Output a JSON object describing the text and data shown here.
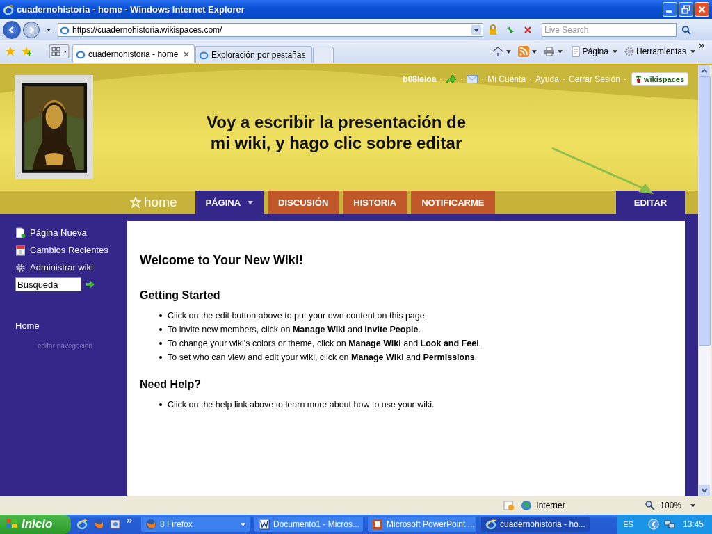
{
  "window": {
    "title": "cuadernohistoria - home - Windows Internet Explorer"
  },
  "address_bar": {
    "url": "https://cuadernohistoria.wikispaces.com/",
    "search_placeholder": "Live Search"
  },
  "tabs": [
    {
      "label": "cuadernohistoria - home",
      "selected": true
    },
    {
      "label": "Exploración por pestañas",
      "selected": false
    }
  ],
  "command_bar": [
    "Página",
    "Herramientas"
  ],
  "page": {
    "user": "b08leioa",
    "links": [
      "Mi Cuenta",
      "Ayuda",
      "Cerrar Sesión"
    ],
    "logo": "wikispaces",
    "banner": [
      "Voy a escribir la presentación de",
      "mi wiki, y hago clic sobre editar"
    ],
    "page_name": "home",
    "nav_tabs": [
      {
        "label": "PÁGINA",
        "selected": true,
        "dropdown": true
      },
      {
        "label": "DISCUSIÓN",
        "selected": false,
        "dropdown": false
      },
      {
        "label": "HISTORIA",
        "selected": false,
        "dropdown": false
      },
      {
        "label": "NOTIFICARME",
        "selected": false,
        "dropdown": false
      }
    ],
    "edit_button": "EDITAR"
  },
  "sidebar": {
    "items": [
      {
        "label": "Página Nueva",
        "kind": "new-page"
      },
      {
        "label": "Cambios Recientes",
        "kind": "calendar"
      },
      {
        "label": "Administrar wiki",
        "kind": "gear"
      }
    ],
    "search_value": "Búsqueda",
    "nav_links": [
      "Home"
    ],
    "edit_nav": "editar navegación"
  },
  "content": {
    "title": "Welcome to Your New Wiki!",
    "sections": [
      {
        "heading": "Getting Started",
        "bullets": [
          "Click on the edit button above to put your own content on this page.",
          "To invite new members, click on **Manage Wiki** and **Invite People**.",
          "To change your wiki's colors or theme, click on **Manage Wiki** and **Look and Feel**.",
          "To set who can view and edit your wiki, click on **Manage Wiki** and **Permissions**."
        ]
      },
      {
        "heading": "Need Help?",
        "bullets": [
          "Click on the help link above to learn more about how to use your wiki."
        ]
      }
    ]
  },
  "status_bar": {
    "zone": "Internet",
    "zoom": "100%"
  },
  "taskbar": {
    "start": "Inicio",
    "tasks": [
      {
        "label": "8 Firefox",
        "kind": "firefox",
        "selected": false
      },
      {
        "label": "Documento1 - Micros...",
        "kind": "word",
        "selected": false
      },
      {
        "label": "Microsoft PowerPoint ...",
        "kind": "powerpoint",
        "selected": false
      },
      {
        "label": "cuadernohistoria - ho...",
        "kind": "ie",
        "selected": true
      }
    ],
    "language": "ES",
    "clock": "13:45"
  }
}
